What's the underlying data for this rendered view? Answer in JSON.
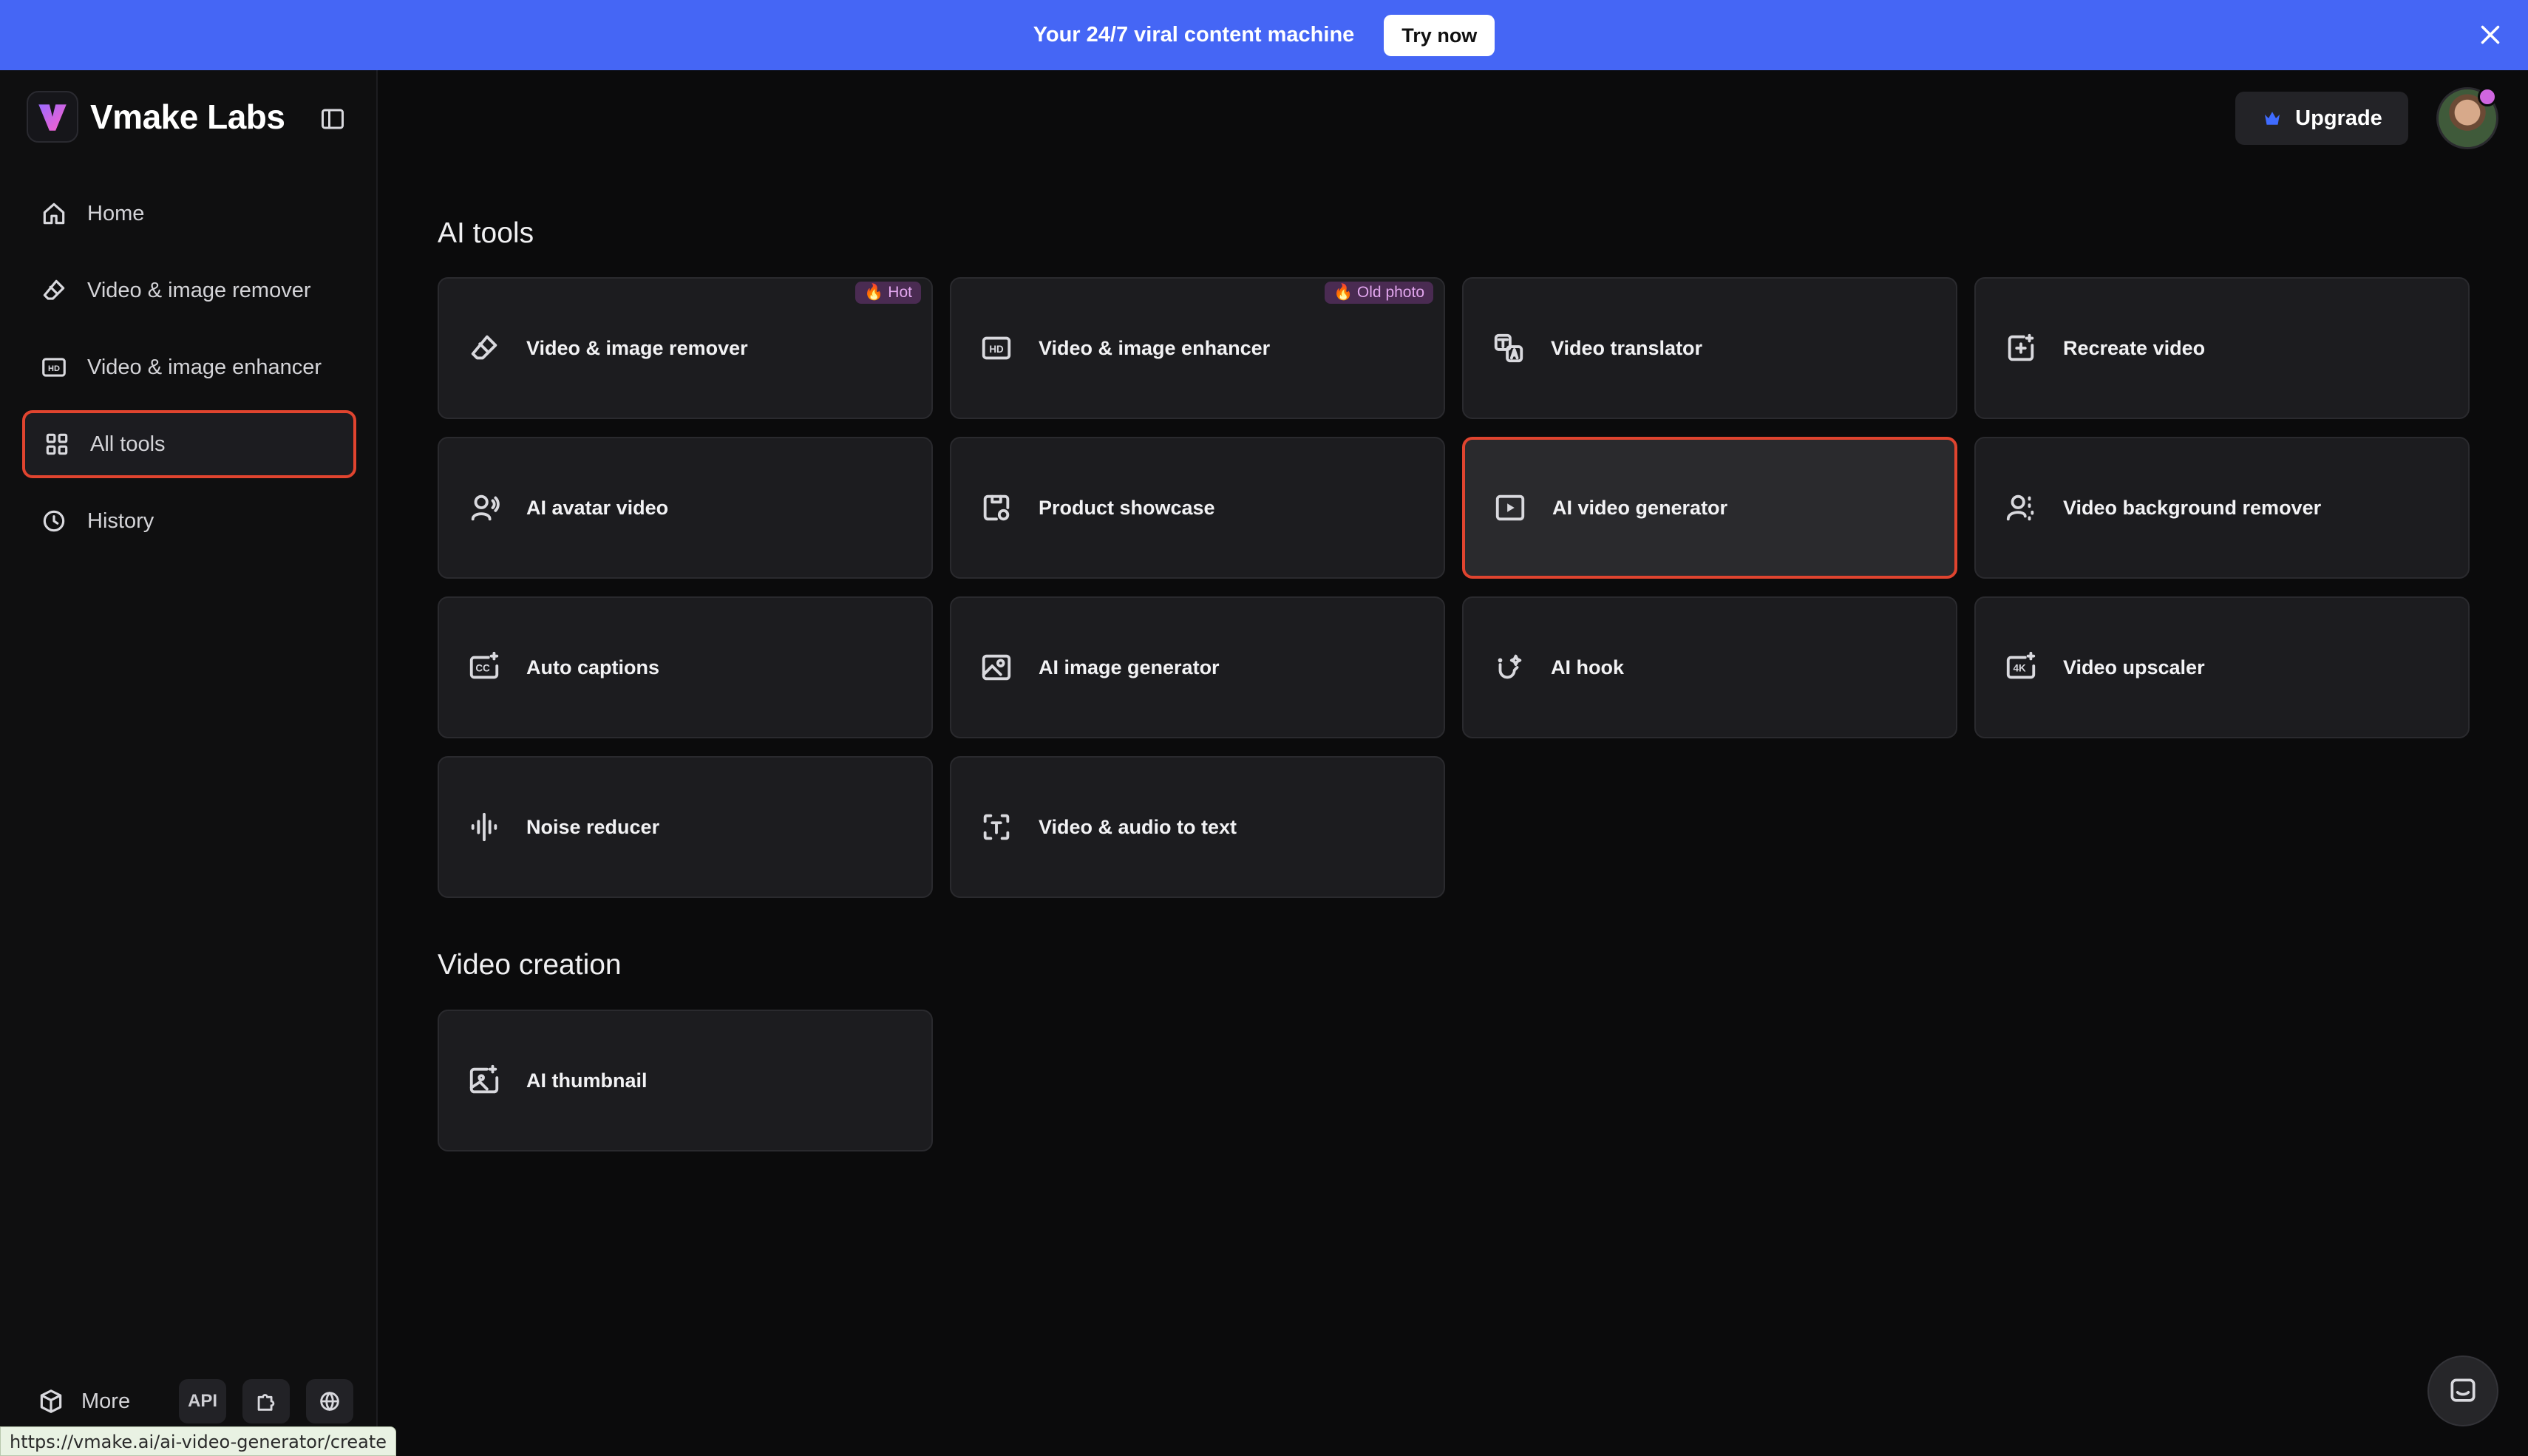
{
  "banner": {
    "text": "Your 24/7 viral content machine",
    "cta": "Try now"
  },
  "sidebar": {
    "logo_text": "Vmake Labs",
    "items": [
      {
        "label": "Home",
        "icon": "home-icon"
      },
      {
        "label": "Video & image remover",
        "icon": "eraser-icon"
      },
      {
        "label": "Video & image enhancer",
        "icon": "hd-icon"
      },
      {
        "label": "All tools",
        "icon": "grid-icon",
        "active": true
      },
      {
        "label": "History",
        "icon": "clock-icon"
      }
    ],
    "more_label": "More",
    "api_label": "API",
    "status_url": "https://vmake.ai/ai-video-generator/create"
  },
  "header": {
    "upgrade_label": "Upgrade"
  },
  "sections": {
    "ai_tools_title": "AI tools",
    "video_creation_title": "Video creation"
  },
  "tools": [
    {
      "label": "Video & image remover",
      "icon": "eraser-icon",
      "badge": "🔥 Hot"
    },
    {
      "label": "Video & image enhancer",
      "icon": "hd-icon",
      "badge": "🔥 Old photo"
    },
    {
      "label": "Video translator",
      "icon": "translate-icon"
    },
    {
      "label": "Recreate video",
      "icon": "recreate-icon"
    },
    {
      "label": "AI avatar video",
      "icon": "avatar-icon"
    },
    {
      "label": "Product showcase",
      "icon": "product-icon"
    },
    {
      "label": "AI video generator",
      "icon": "play-icon",
      "active": true
    },
    {
      "label": "Video background remover",
      "icon": "bg-remover-icon"
    },
    {
      "label": "Auto captions",
      "icon": "cc-icon"
    },
    {
      "label": "AI image generator",
      "icon": "image-icon"
    },
    {
      "label": "AI hook",
      "icon": "hook-icon"
    },
    {
      "label": "Video upscaler",
      "icon": "4k-icon"
    },
    {
      "label": "Noise reducer",
      "icon": "waveform-icon"
    },
    {
      "label": "Video & audio to text",
      "icon": "text-scan-icon"
    }
  ],
  "video_creation": [
    {
      "label": "AI thumbnail",
      "icon": "thumbnail-icon"
    }
  ],
  "colors": {
    "banner": "#4566f5",
    "active_border": "#e0442f",
    "badge_bg": "#4a2b52"
  }
}
